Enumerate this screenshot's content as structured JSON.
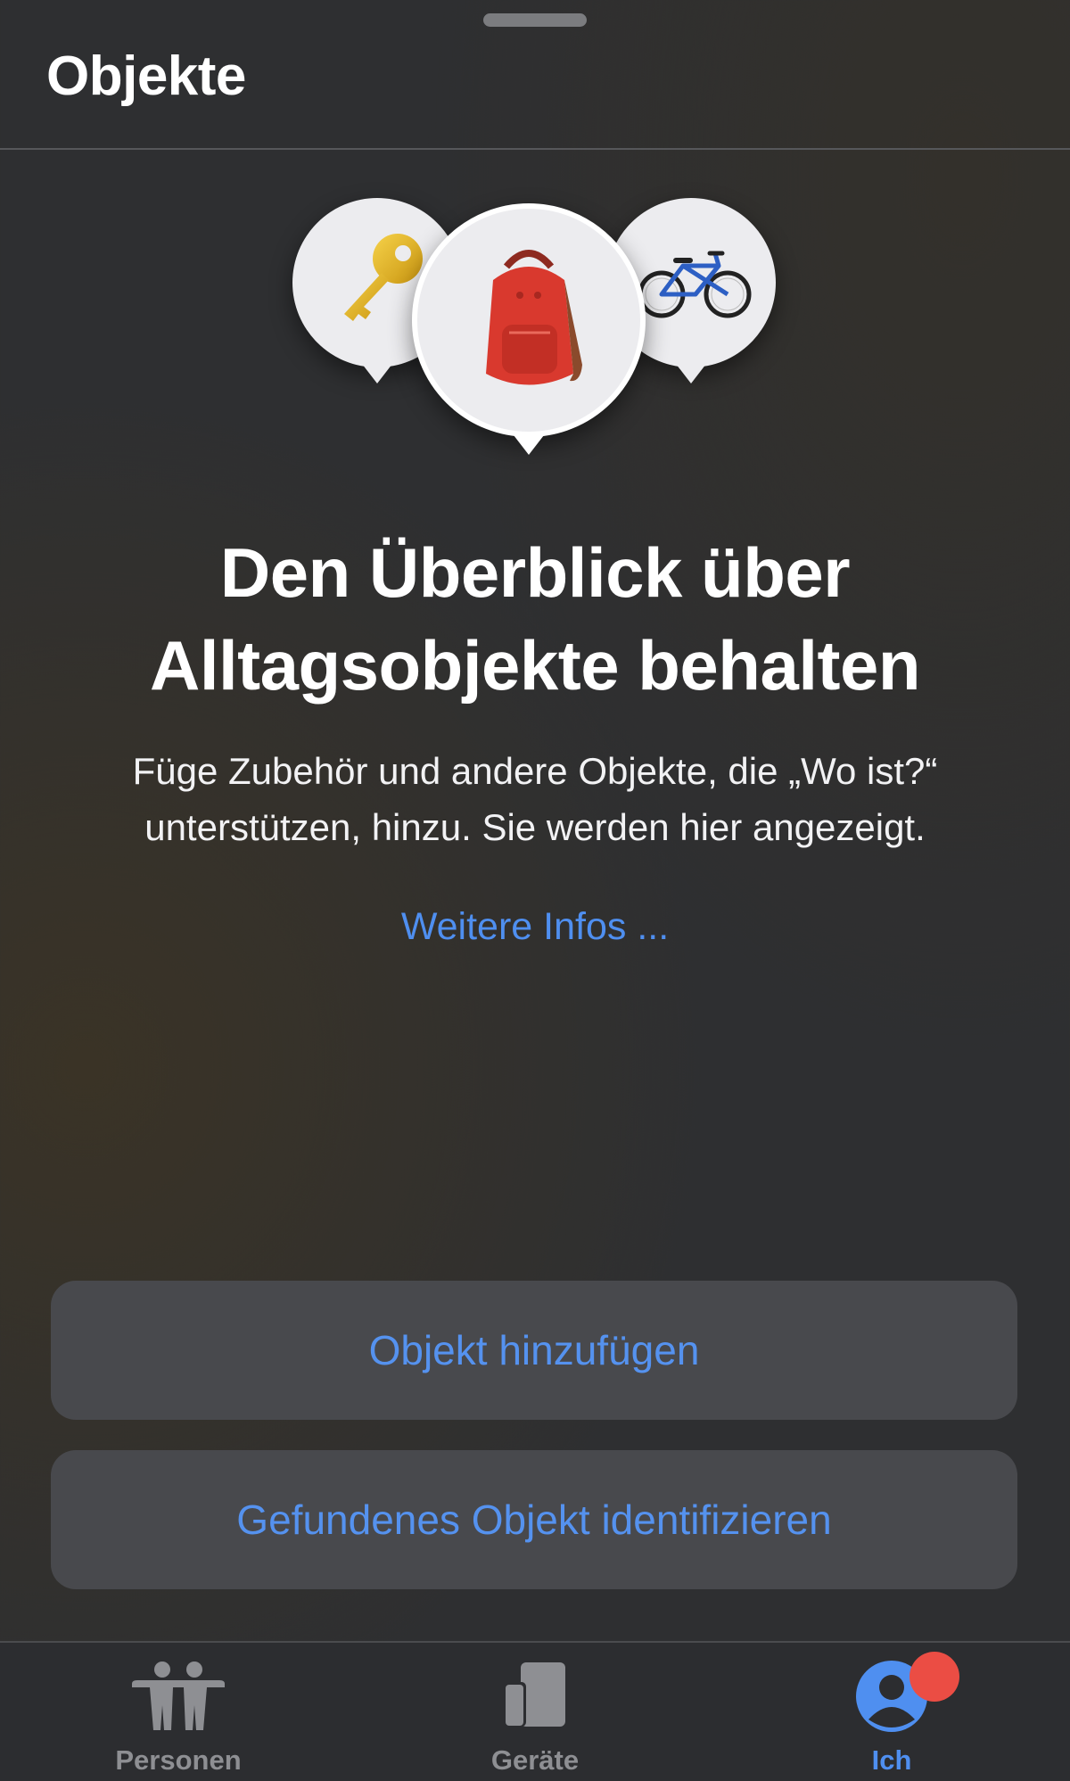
{
  "header": {
    "title": "Objekte"
  },
  "illustration": {
    "pins": [
      {
        "icon": "key-icon"
      },
      {
        "icon": "backpack-icon"
      },
      {
        "icon": "bicycle-icon"
      }
    ]
  },
  "empty_state": {
    "title": "Den Überblick über Alltagsobjekte behalten",
    "body": "Füge Zubehör und andere Objekte, die „Wo ist?“ unterstützen, hinzu. Sie werden hier angezeigt.",
    "link": "Weitere Infos ..."
  },
  "actions": {
    "add_label": "Objekt hinzufügen",
    "identify_label": "Gefundenes Objekt identifizieren"
  },
  "tabbar": {
    "tabs": [
      {
        "label": "Personen",
        "icon": "people-icon",
        "selected": false
      },
      {
        "label": "Geräte",
        "icon": "devices-icon",
        "selected": false
      },
      {
        "label": "Ich",
        "icon": "person-circle-icon",
        "selected": true,
        "badge": true
      }
    ]
  },
  "colors": {
    "accent": "#4f8ff0",
    "background": "#2e2f31",
    "button": "#48494d",
    "badge": "#eb4d44"
  }
}
